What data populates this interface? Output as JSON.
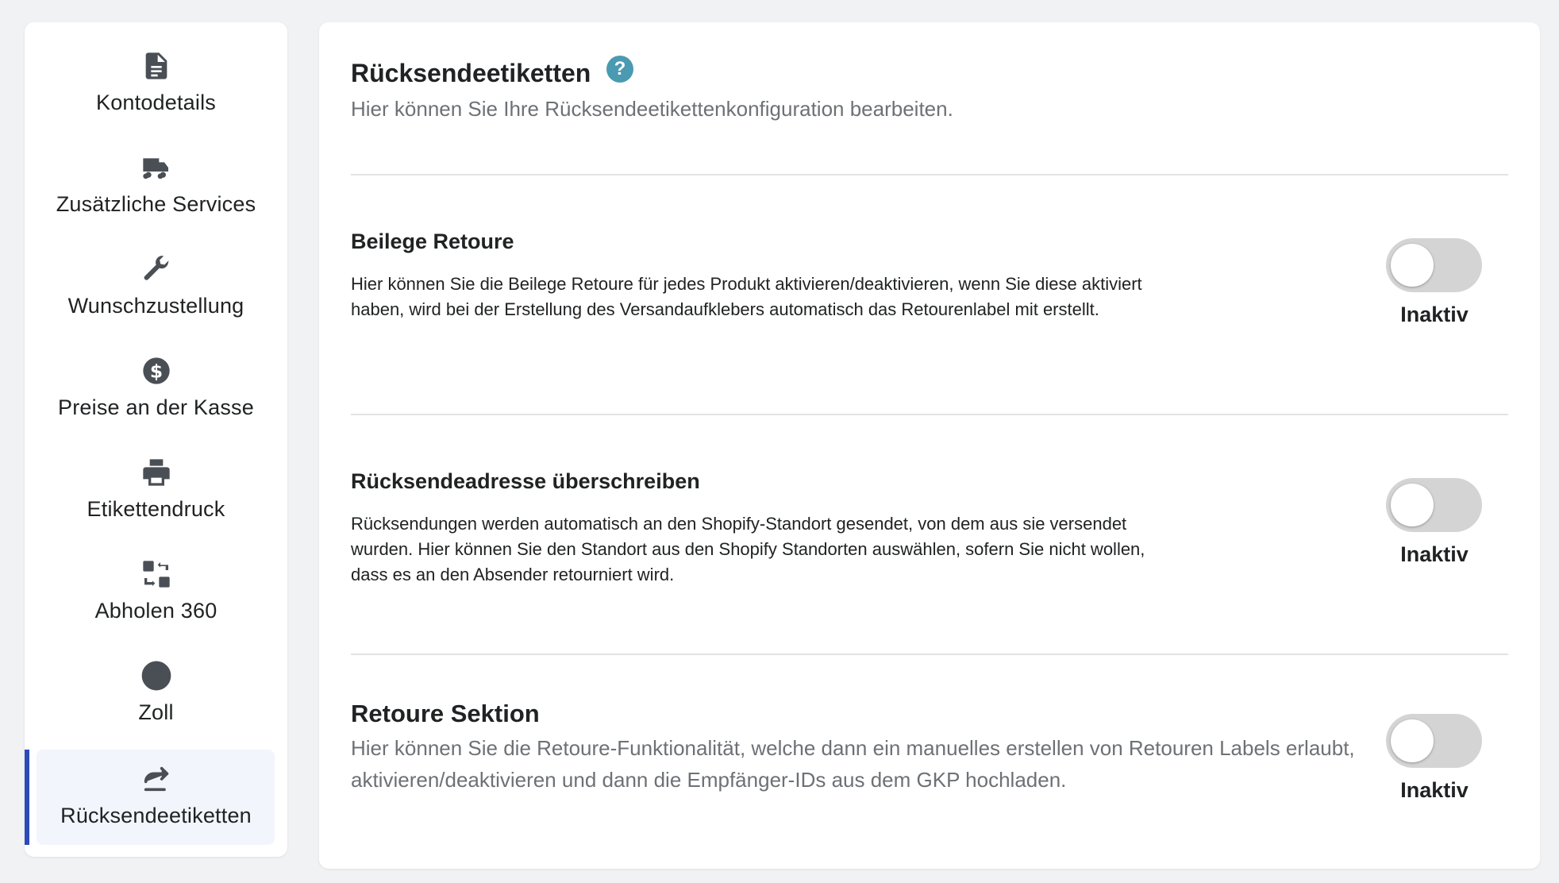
{
  "sidebar": {
    "items": [
      {
        "label": "Kontodetails",
        "icon": "document-icon"
      },
      {
        "label": "Zusätzliche Services",
        "icon": "truck-icon"
      },
      {
        "label": "Wunschzustellung",
        "icon": "wrench-icon"
      },
      {
        "label": "Preise an der Kasse",
        "icon": "dollar-icon"
      },
      {
        "label": "Etikettendruck",
        "icon": "printer-icon"
      },
      {
        "label": "Abholen 360",
        "icon": "swap-icon"
      },
      {
        "label": "Zoll",
        "icon": "globe-icon"
      },
      {
        "label": "Rücksendeetiketten",
        "icon": "return-arrow-icon",
        "active": true
      }
    ]
  },
  "main": {
    "title": "Rücksendeetiketten",
    "help_glyph": "?",
    "subtitle": "Hier können Sie Ihre Rücksendeetikettenkonfiguration bearbeiten.",
    "sections": [
      {
        "title": "Beilege Retoure",
        "description": "Hier können Sie die Beilege Retoure für jedes Produkt aktivieren/deaktivieren, wenn Sie diese aktiviert haben, wird bei der Erstellung des Versandaufklebers automatisch das Retourenlabel mit erstellt.",
        "toggle_state": "Inaktiv",
        "enabled": false
      },
      {
        "title": "Rücksendeadresse überschreiben",
        "description": "Rücksendungen werden automatisch an den Shopify-Standort gesendet, von dem aus sie versendet wurden. Hier können Sie den Standort aus den Shopify Standorten auswählen, sofern Sie nicht wollen, dass es an den Absender retourniert wird.",
        "toggle_state": "Inaktiv",
        "enabled": false
      },
      {
        "title": "Retoure Sektion",
        "description": "Hier können Sie die Retoure-Funktionalität, welche dann ein manuelles erstellen von Retouren Labels erlaubt, aktivieren/deaktivieren und dann die Empfänger-IDs aus dem GKP hochladen.",
        "toggle_state": "Inaktiv",
        "enabled": false
      }
    ]
  },
  "colors": {
    "accent": "#2c4ab8",
    "help": "#4a9ab1",
    "toggle_off": "#d4d4d4",
    "active_bg": "#f2f5fc"
  }
}
